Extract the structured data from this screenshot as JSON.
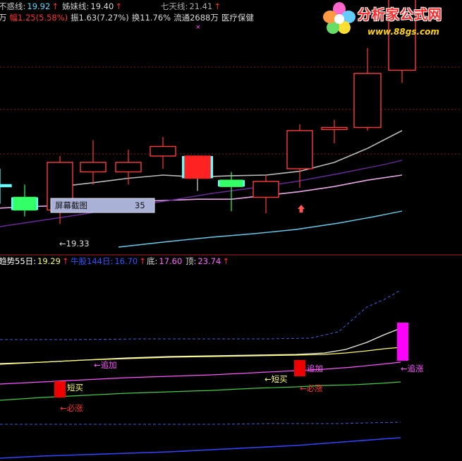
{
  "header": {
    "items": [
      {
        "label": "不惑线:",
        "value": "19.92",
        "arrow": "↑",
        "label_color": "#cccccc",
        "value_color": "#55ddff"
      },
      {
        "label": "姊妹线:",
        "value": "19.40",
        "arrow": "↑",
        "label_color": "#cccccc",
        "value_color": "#dddddd"
      },
      {
        "label": "七天线:",
        "value": "21.41",
        "arrow": "↑",
        "label_color": "#aaaaaa",
        "value_color": "#aaaaaa"
      }
    ],
    "line2_prefix": "万",
    "line2_change": "幅1.25(5.58%)",
    "line2_amplitude": "振1.63(7.27%)",
    "line2_turnover": "换11.76%",
    "line2_float": "流通2688万",
    "line2_sector": "医疗保健",
    "marker": "×"
  },
  "logo": {
    "title": "分析家公式网",
    "url": "www.88gs.com"
  },
  "main_panel": {
    "popup_label": "屏幕截图",
    "popup_value": "35",
    "low_label": "←19.33"
  },
  "sub_panel": {
    "legend": [
      {
        "label": "趋势55日:",
        "value": "19.29",
        "arrow": "↑",
        "label_color": "#ffffff",
        "value_color": "#ffff66"
      },
      {
        "label": "牛股144日:",
        "value": "16.70",
        "arrow": "↑",
        "label_color": "#3355ff",
        "value_color": "#3355ff"
      },
      {
        "label": "底:",
        "value": "17.60",
        "arrow": "",
        "label_color": "#dddddd",
        "value_color": "#ff66ff"
      },
      {
        "label": "顶:",
        "value": "23.74",
        "arrow": "↑",
        "label_color": "#dddddd",
        "value_color": "#ff66ff"
      }
    ],
    "annotations": {
      "zhuijia1": "←追加",
      "duanmai1": "短买",
      "bizhang1": "←必涨",
      "zhuijia2": "追加",
      "duanmai2": "←短买",
      "bizhang2": "←必涨",
      "zhuizhang": "←追涨"
    }
  },
  "chart_data": {
    "type": "candlestick",
    "candles": [
      {
        "open": 19.95,
        "close": 19.95,
        "high": 20.2,
        "low": 19.65,
        "color": "cyan"
      },
      {
        "open": 19.75,
        "close": 19.55,
        "high": 19.95,
        "low": 19.45,
        "color": "green"
      },
      {
        "open": 19.55,
        "close": 20.3,
        "high": 20.4,
        "low": 19.33,
        "color": "red"
      },
      {
        "open": 20.15,
        "close": 20.3,
        "high": 20.65,
        "low": 19.95,
        "color": "red"
      },
      {
        "open": 20.15,
        "close": 20.3,
        "high": 20.5,
        "low": 19.95,
        "color": "red"
      },
      {
        "open": 20.4,
        "close": 20.55,
        "high": 20.7,
        "low": 20.2,
        "color": "red"
      },
      {
        "open": 20.05,
        "close": 20.4,
        "high": 20.4,
        "low": 19.85,
        "color": "filled-red"
      },
      {
        "open": 19.95,
        "close": 20.02,
        "high": 20.15,
        "low": 19.53,
        "color": "green"
      },
      {
        "open": 19.75,
        "close": 20.0,
        "high": 20.1,
        "low": 19.5,
        "color": "red"
      },
      {
        "open": 20.2,
        "close": 20.8,
        "high": 20.9,
        "low": 19.9,
        "color": "red"
      },
      {
        "open": 20.82,
        "close": 20.85,
        "high": 20.97,
        "low": 20.6,
        "color": "red"
      },
      {
        "open": 20.85,
        "close": 21.7,
        "high": 22.1,
        "low": 20.8,
        "color": "red"
      },
      {
        "open": 21.75,
        "close": 23.25,
        "high": 23.5,
        "low": 21.55,
        "color": "red"
      }
    ],
    "series": [
      {
        "name": "不惑线",
        "color": "#e8a8e8",
        "values": [
          19.58,
          19.6,
          19.62,
          19.65,
          19.68,
          19.7,
          19.72,
          19.72,
          19.78,
          19.84,
          19.92,
          20.02,
          20.1
        ]
      },
      {
        "name": "姊妹线",
        "color": "#bbbbbb",
        "values": [
          null,
          null,
          19.92,
          19.98,
          20.05,
          20.1,
          20.07,
          20.09,
          20.1,
          20.16,
          20.3,
          20.52,
          20.8
        ]
      }
    ]
  }
}
